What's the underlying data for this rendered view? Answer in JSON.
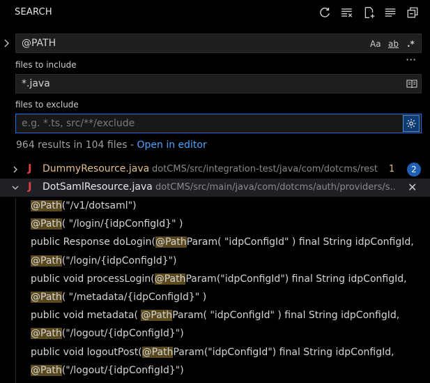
{
  "header": {
    "title": "SEARCH",
    "icons": [
      "refresh-icon",
      "clear-results-icon",
      "new-search-editor-icon",
      "view-as-tree-icon",
      "collapse-all-icon"
    ]
  },
  "search": {
    "value": "@PATH",
    "options": {
      "match_case": "Aa",
      "whole_word": "ab",
      "regex": ".*"
    },
    "more_label": "···"
  },
  "include": {
    "label": "files to include",
    "value": "*.java"
  },
  "exclude": {
    "label": "files to exclude",
    "placeholder": "e.g. *.ts, src/**/exclude"
  },
  "summary": {
    "text": "964 results in 104 files - ",
    "link": "Open in editor"
  },
  "results": {
    "files": [
      {
        "name": "DummyResource.java",
        "path": "dotCMS/src/integration-test/java/com/dotcms/rest",
        "count": "1",
        "badge": "2"
      },
      {
        "name": "DotSamlResource.java",
        "path": "dotCMS/src/main/java/com/dotcms/auth/providers/s...",
        "close": "✕"
      }
    ],
    "matches": [
      {
        "before": "",
        "hit": "@Path",
        "after": "(\"/v1/dotsaml\")"
      },
      {
        "before": "",
        "hit": "@Path",
        "after": "( \"/login/{idpConfigId}\" )"
      },
      {
        "before": "public Response doLogin(",
        "hit": "@Path",
        "after": "Param( \"idpConfigId\" ) final String idpConfigId,"
      },
      {
        "before": "",
        "hit": "@Path",
        "after": "(\"/login/{idpConfigId}\")"
      },
      {
        "before": "public void processLogin(",
        "hit": "@Path",
        "after": "Param(\"idpConfigId\") final String idpConfigId,"
      },
      {
        "before": "",
        "hit": "@Path",
        "after": "( \"/metadata/{idpConfigId}\" )"
      },
      {
        "before": "public void metadata( ",
        "hit": "@Path",
        "after": "Param( \"idpConfigId\" ) final String idpConfigId,"
      },
      {
        "before": "",
        "hit": "@Path",
        "after": "(\"/logout/{idpConfigId}\")"
      },
      {
        "before": "public void logoutPost(",
        "hit": "@Path",
        "after": "Param(\"idpConfigId\") final String idpConfigId,"
      },
      {
        "before": "",
        "hit": "@Path",
        "after": "(\"/logout/{idpConfigId}\")"
      }
    ]
  },
  "colors": {
    "background": "#000000",
    "accent": "#1f6feb",
    "file_name": "#e2c08d",
    "java_icon": "#e04040",
    "badge": "#1f5fb4",
    "match_highlight": "#5a4a1e"
  }
}
